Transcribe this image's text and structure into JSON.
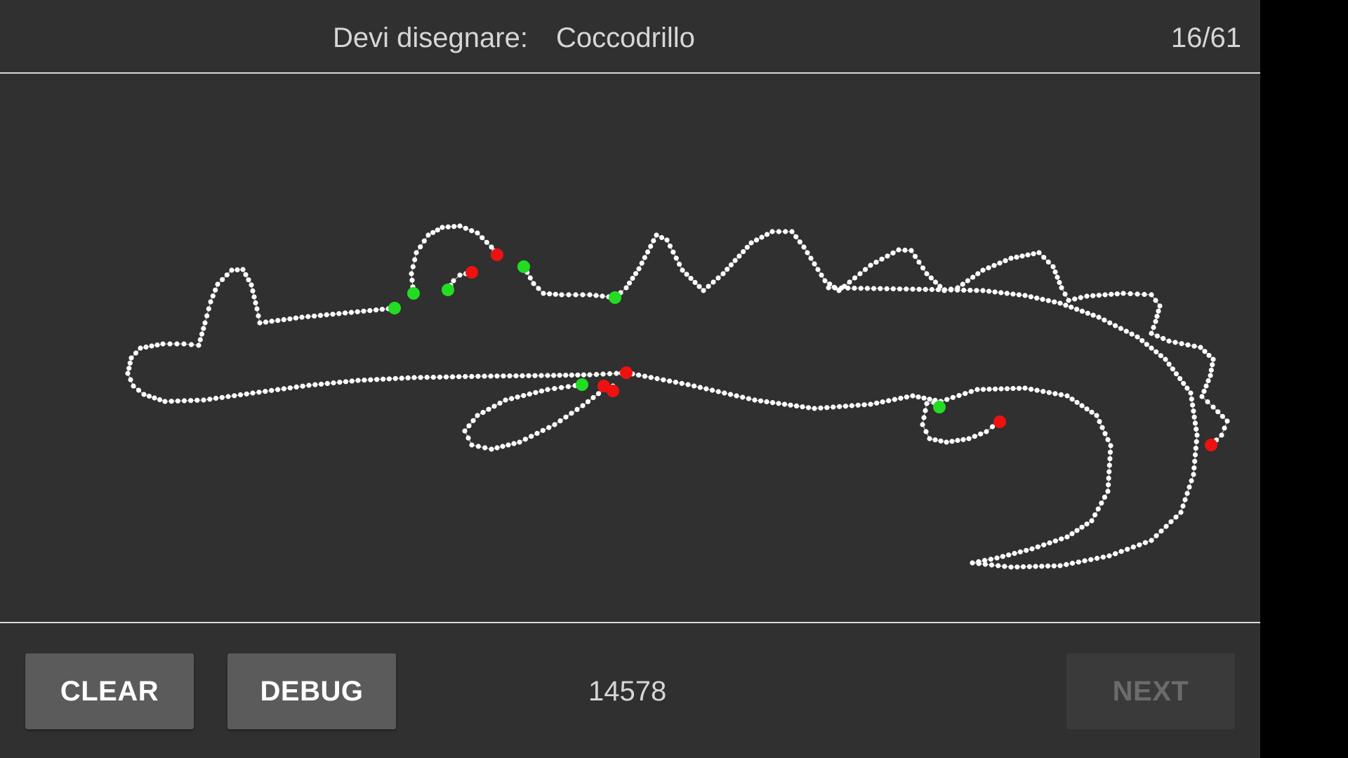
{
  "header": {
    "prompt_label": "Devi disegnare:",
    "prompt_word": "Coccodrillo",
    "progress": "16/61"
  },
  "footer": {
    "clear_label": "CLEAR",
    "debug_label": "DEBUG",
    "counter": "14578",
    "next_label": "NEXT"
  },
  "colors": {
    "background": "#303030",
    "stroke": "#ffffff",
    "stroke_start": "#22dd22",
    "stroke_end": "#ee1111",
    "button": "#5b5b5b",
    "button_disabled": "#3a3a3a"
  }
}
